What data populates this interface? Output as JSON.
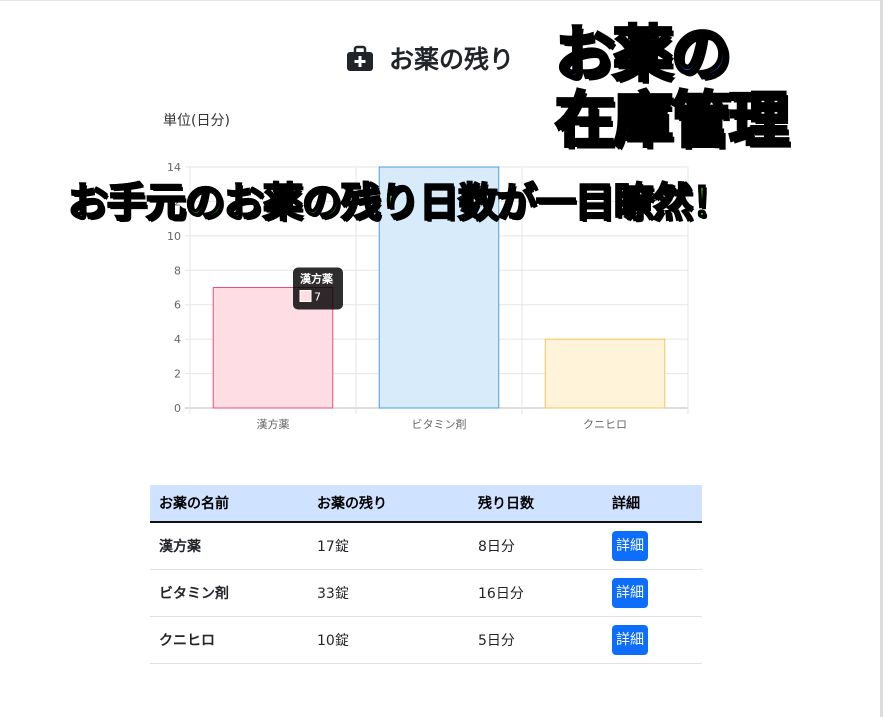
{
  "header": {
    "title": "お薬の残り",
    "icon": "medical-kit-icon"
  },
  "promo": {
    "line1": "お薬の",
    "line2": "在庫管理",
    "subtitle": "お手元のお薬の残り日数が一目瞭然！",
    "colors": {
      "title": "#1565ff",
      "subtitle": "#44dd11"
    }
  },
  "chart_data": {
    "type": "bar",
    "ylabel": "単位(日分)",
    "categories": [
      "漢方薬",
      "ビタミン剤",
      "クニヒロ"
    ],
    "values": [
      7,
      14,
      4
    ],
    "ylim": [
      0,
      14
    ],
    "yticks": [
      "0",
      "2",
      "4",
      "6",
      "8",
      "10",
      "12",
      "14"
    ],
    "grid": true,
    "colors": [
      {
        "fill": "#ffdde5",
        "stroke": "#e94f78"
      },
      {
        "fill": "#d8ebfa",
        "stroke": "#4c9fdc"
      },
      {
        "fill": "#fff3d9",
        "stroke": "#f5c55a"
      }
    ],
    "tooltip": {
      "title": "漢方薬",
      "value": "7",
      "category_index": 0
    }
  },
  "table": {
    "headers": [
      "お薬の名前",
      "お薬の残り",
      "残り日数",
      "詳細"
    ],
    "rows": [
      {
        "name": "漢方薬",
        "remaining": "17錠",
        "days": "8日分",
        "button": "詳細"
      },
      {
        "name": "ビタミン剤",
        "remaining": "33錠",
        "days": "16日分",
        "button": "詳細"
      },
      {
        "name": "クニヒロ",
        "remaining": "10錠",
        "days": "5日分",
        "button": "詳細"
      }
    ]
  }
}
